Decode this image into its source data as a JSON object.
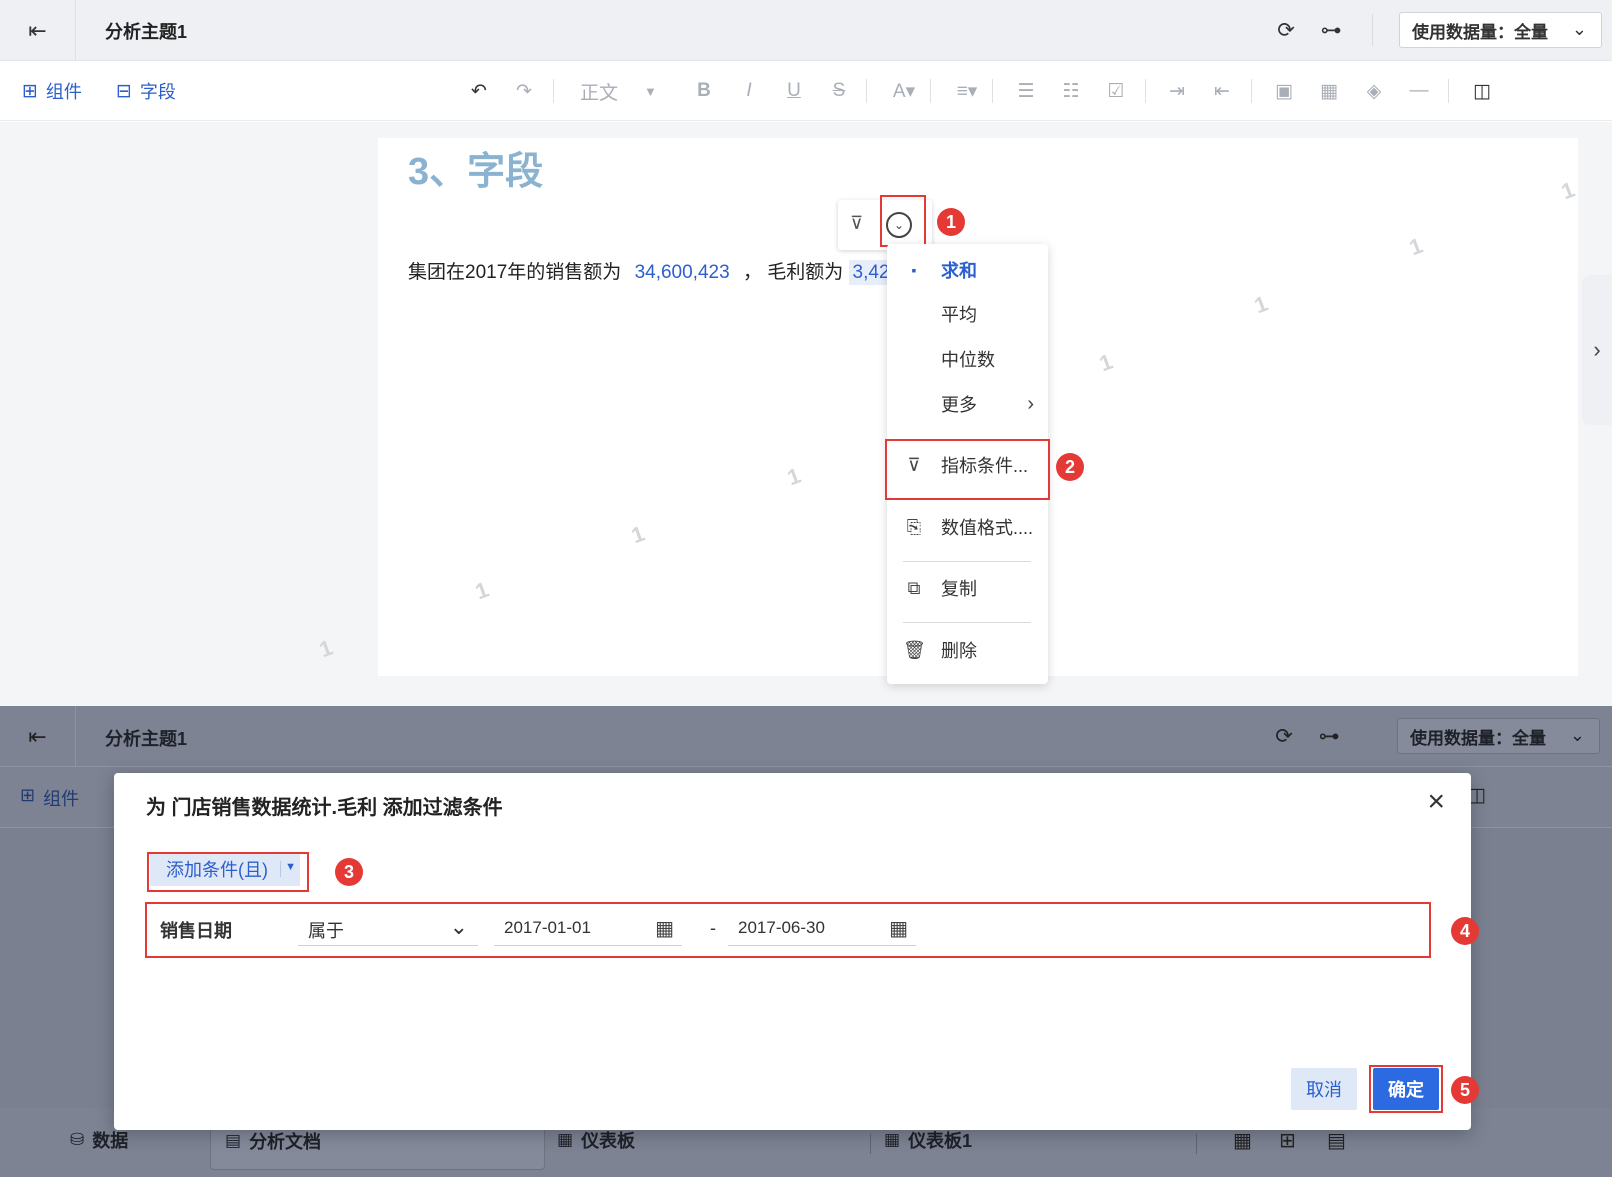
{
  "top": {
    "header": {
      "title": "分析主题1",
      "data_amount": "使用数据量：全量"
    },
    "toolbar": {
      "component_label": "组件",
      "field_label": "字段",
      "style_label": "正文"
    },
    "doc": {
      "heading": "3、字段",
      "sentence_prefix": "集团在2017年的销售额为",
      "sales_value": "34,600,423",
      "comma": "，",
      "sentence_mid": "毛利额为",
      "profit_value": "3,429"
    },
    "watermark": "1",
    "menu": {
      "items": [
        {
          "label": "求和",
          "active": true
        },
        {
          "label": "平均"
        },
        {
          "label": "中位数"
        },
        {
          "label": "更多"
        },
        {
          "label": "指标条件..."
        },
        {
          "label": "数值格式...."
        },
        {
          "label": "复制"
        },
        {
          "label": "删除"
        }
      ]
    }
  },
  "bottom": {
    "header": {
      "title": "分析主题1",
      "data_amount": "使用数据量：全量"
    },
    "toolbar": {
      "component_label": "组件"
    },
    "dialog": {
      "title": "为 门店销售数据统计.毛利 添加过滤条件",
      "add_condition": "添加条件(且)",
      "field": "销售日期",
      "operator": "属于",
      "date_from": "2017-01-01",
      "date_sep": "-",
      "date_to": "2017-06-30",
      "cancel": "取消",
      "ok": "确定"
    },
    "tabs": [
      {
        "label": "数据"
      },
      {
        "label": "分析文档"
      },
      {
        "label": "仪表板"
      },
      {
        "label": "仪表板1"
      }
    ]
  },
  "badges": [
    "1",
    "2",
    "3",
    "4",
    "5"
  ],
  "colors": {
    "accent": "#2b5fcf",
    "highlight": "#e53935",
    "primary_button": "#2b6ae0",
    "overlay": "#7d8393"
  }
}
